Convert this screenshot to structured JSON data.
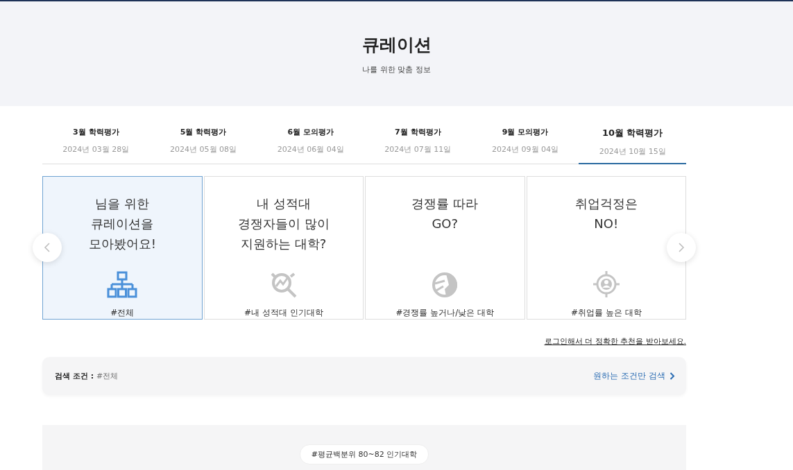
{
  "header": {
    "title": "큐레이션",
    "subtitle": "나를 위한 맞춤 정보"
  },
  "tabs": [
    {
      "label": "3월 학력평가",
      "date": "2024년 03월 28일",
      "selected": false
    },
    {
      "label": "5월 학력평가",
      "date": "2024년 05월 08일",
      "selected": false
    },
    {
      "label": "6월 모의평가",
      "date": "2024년 06월 04일",
      "selected": false
    },
    {
      "label": "7월 학력평가",
      "date": "2024년 07월 11일",
      "selected": false
    },
    {
      "label": "9월 모의평가",
      "date": "2024년 09월 04일",
      "selected": false
    },
    {
      "label": "10월 학력평가",
      "date": "2024년 10월 15일",
      "selected": true
    }
  ],
  "cards": [
    {
      "kind": "all",
      "title": "님을 위한\n큐레이션을\n모아봤어요!",
      "tag": "#전체",
      "selected": true
    },
    {
      "kind": "popular",
      "title": "내 성적대\n경쟁자들이 많이\n지원하는 대학?",
      "tag": "#내 성적대 인기대학",
      "selected": false
    },
    {
      "kind": "competition",
      "title": "경쟁률 따라\nGO?",
      "tag": "#경쟁률 높거나/낮은 대학",
      "selected": false
    },
    {
      "kind": "employment",
      "title": "취업걱정은\nNO!",
      "tag": "#취업률 높은 대학",
      "selected": false
    }
  ],
  "login_link": "로그인해서 더 정확한 추천을 받아보세요.",
  "search": {
    "label": "검색 조건 :",
    "value": "#전체",
    "action": "원하는 조건만 검색"
  },
  "result_tag": "#평균백분위 80~82 인기대학"
}
